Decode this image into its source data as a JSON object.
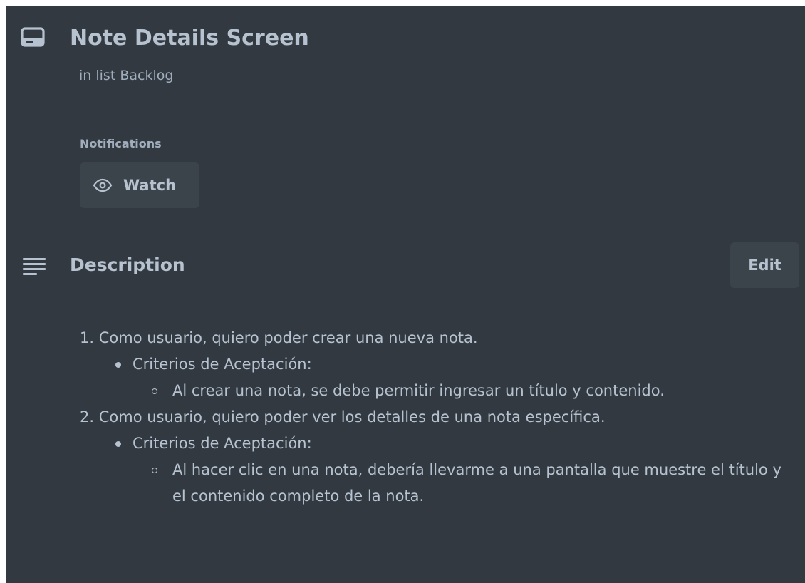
{
  "card": {
    "title": "Note Details Screen",
    "list_prefix": "in list",
    "list_name": "Backlog"
  },
  "notifications": {
    "label": "Notifications",
    "watch_label": "Watch"
  },
  "description": {
    "title": "Description",
    "edit_label": "Edit",
    "items": [
      {
        "number": "1.",
        "story": "Como usuario, quiero poder crear una nueva nota.",
        "criteria_label": "Criterios de Aceptación:",
        "criteria": "Al crear una nota, se debe permitir ingresar un título y contenido."
      },
      {
        "number": "2.",
        "story": "Como usuario, quiero poder ver los detalles de una nota específica.",
        "criteria_label": "Criterios de Aceptación:",
        "criteria": "Al hacer clic en una nota, debería llevarme a una pantalla que muestre el título y el contenido completo de la nota."
      }
    ]
  },
  "icons": {
    "card": "card-icon",
    "eye": "eye-icon",
    "description": "description-lines-icon"
  },
  "colors": {
    "background": "#323940",
    "button": "#3b434b",
    "text": "#b6c2cf",
    "subtle_text": "#9fadbc"
  }
}
